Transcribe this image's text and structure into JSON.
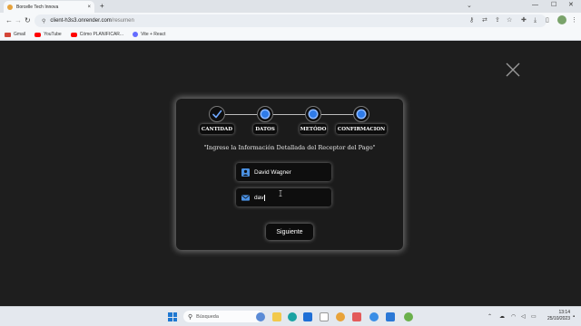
{
  "browser": {
    "tab_title": "Borcelle Tech Innova",
    "tab_close": "×",
    "new_tab": "+",
    "url_host": "client-h3s3.onrender.com",
    "url_path": "/resumen",
    "bookmarks": [
      {
        "label": "Gmail",
        "icon_color": "#d44638",
        "icon": "gmail-icon"
      },
      {
        "label": "YouTube",
        "icon_color": "#ff0000",
        "icon": "youtube-icon"
      },
      {
        "label": "Cómo PLANIFICAR...",
        "icon_color": "#ff0000",
        "icon": "youtube-icon"
      },
      {
        "label": "Vite + React",
        "icon_color": "#646cff",
        "icon": "globe-icon"
      }
    ]
  },
  "stepper": {
    "steps": [
      {
        "label": "CANTIDAD",
        "state": "completed"
      },
      {
        "label": "DATOS",
        "state": "active"
      },
      {
        "label": "METÓDO",
        "state": "active"
      },
      {
        "label": "CONFIRMACION",
        "state": "active"
      }
    ]
  },
  "form": {
    "subtitle": "\"Ingrese la Información Detallada del Receptor del Pago\"",
    "name_value": "David Wagner",
    "email_value": "dav",
    "next_button": "Siguiente"
  },
  "taskbar": {
    "search_label": "Búsqueda",
    "time": "13:14",
    "date": "25/10/2023"
  },
  "colors": {
    "accent": "#2f7be8",
    "page_bg": "#1e1e1e",
    "modal_bg": "#1b1b1b"
  }
}
